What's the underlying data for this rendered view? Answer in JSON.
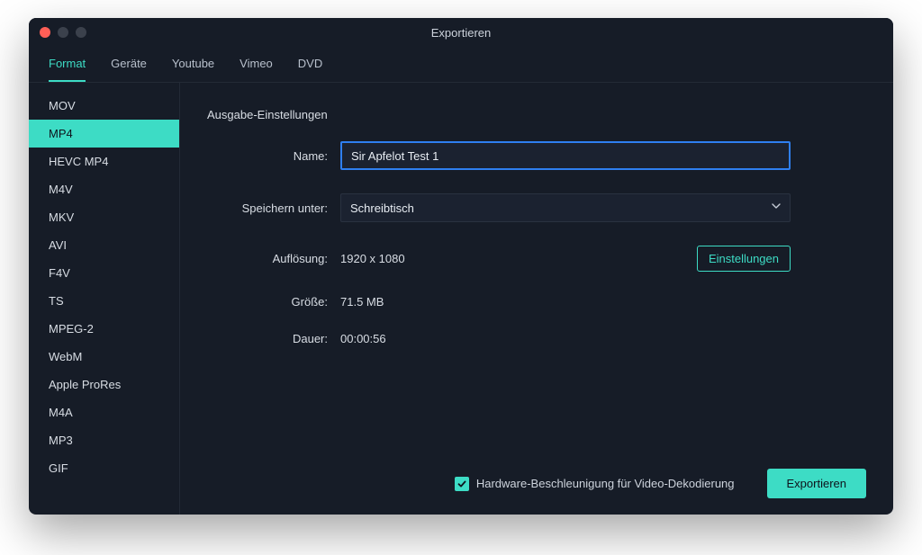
{
  "window": {
    "title": "Exportieren"
  },
  "tabs": [
    {
      "label": "Format",
      "active": true
    },
    {
      "label": "Geräte",
      "active": false
    },
    {
      "label": "Youtube",
      "active": false
    },
    {
      "label": "Vimeo",
      "active": false
    },
    {
      "label": "DVD",
      "active": false
    }
  ],
  "sidebar": {
    "items": [
      {
        "label": "MOV",
        "active": false
      },
      {
        "label": "MP4",
        "active": true
      },
      {
        "label": "HEVC MP4",
        "active": false
      },
      {
        "label": "M4V",
        "active": false
      },
      {
        "label": "MKV",
        "active": false
      },
      {
        "label": "AVI",
        "active": false
      },
      {
        "label": "F4V",
        "active": false
      },
      {
        "label": "TS",
        "active": false
      },
      {
        "label": "MPEG-2",
        "active": false
      },
      {
        "label": "WebM",
        "active": false
      },
      {
        "label": "Apple ProRes",
        "active": false
      },
      {
        "label": "M4A",
        "active": false
      },
      {
        "label": "MP3",
        "active": false
      },
      {
        "label": "GIF",
        "active": false
      }
    ]
  },
  "main": {
    "section_title": "Ausgabe-Einstellungen",
    "name_label": "Name:",
    "name_value": "Sir Apfelot Test 1",
    "save_label": "Speichern unter:",
    "save_value": "Schreibtisch",
    "resolution_label": "Auflösung:",
    "resolution_value": "1920 x 1080",
    "settings_button": "Einstellungen",
    "size_label": "Größe:",
    "size_value": "71.5 MB",
    "duration_label": "Dauer:",
    "duration_value": "00:00:56"
  },
  "footer": {
    "checkbox_label": "Hardware-Beschleunigung für Video-Dekodierung",
    "checkbox_checked": true,
    "export_button": "Exportieren"
  }
}
